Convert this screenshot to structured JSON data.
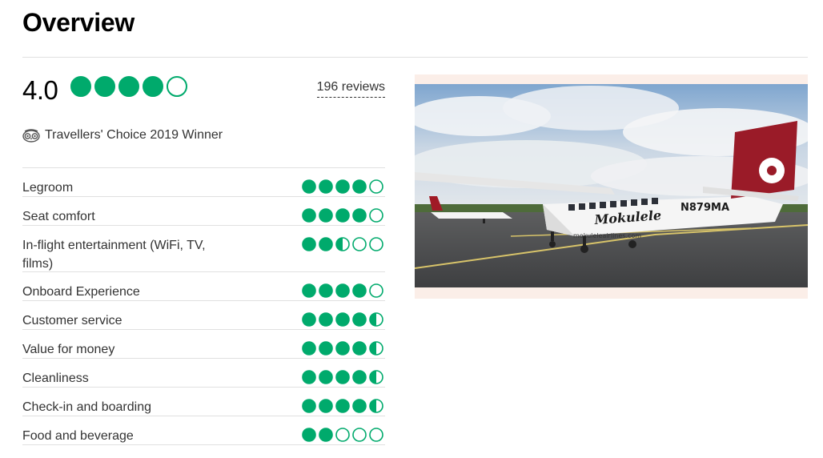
{
  "header": {
    "title": "Overview"
  },
  "summary": {
    "rating": "4.0",
    "rating_value": 4.0,
    "reviews": "196 reviews",
    "award": "Travellers' Choice 2019 Winner",
    "award_icon": "travellers-choice-owl-icon"
  },
  "colors": {
    "bubble_green": "#00aa6c",
    "text_dark": "#333333",
    "rule": "#e0e0e0",
    "photo_frame": "#fbeee8"
  },
  "ratings": [
    {
      "label": "Legroom",
      "value": 4.0
    },
    {
      "label": "Seat comfort",
      "value": 4.0
    },
    {
      "label": "In-flight entertainment (WiFi, TV, films)",
      "value": 2.5
    },
    {
      "label": "Onboard Experience",
      "value": 4.0
    },
    {
      "label": "Customer service",
      "value": 4.5
    },
    {
      "label": "Value for money",
      "value": 4.5
    },
    {
      "label": "Cleanliness",
      "value": 4.5
    },
    {
      "label": "Check-in and boarding",
      "value": 4.5
    },
    {
      "label": "Food and beverage",
      "value": 2.0
    }
  ],
  "photo": {
    "tail_number": "N879MA",
    "livery": "Mokulele",
    "website": "mokuleleairlines.com"
  }
}
